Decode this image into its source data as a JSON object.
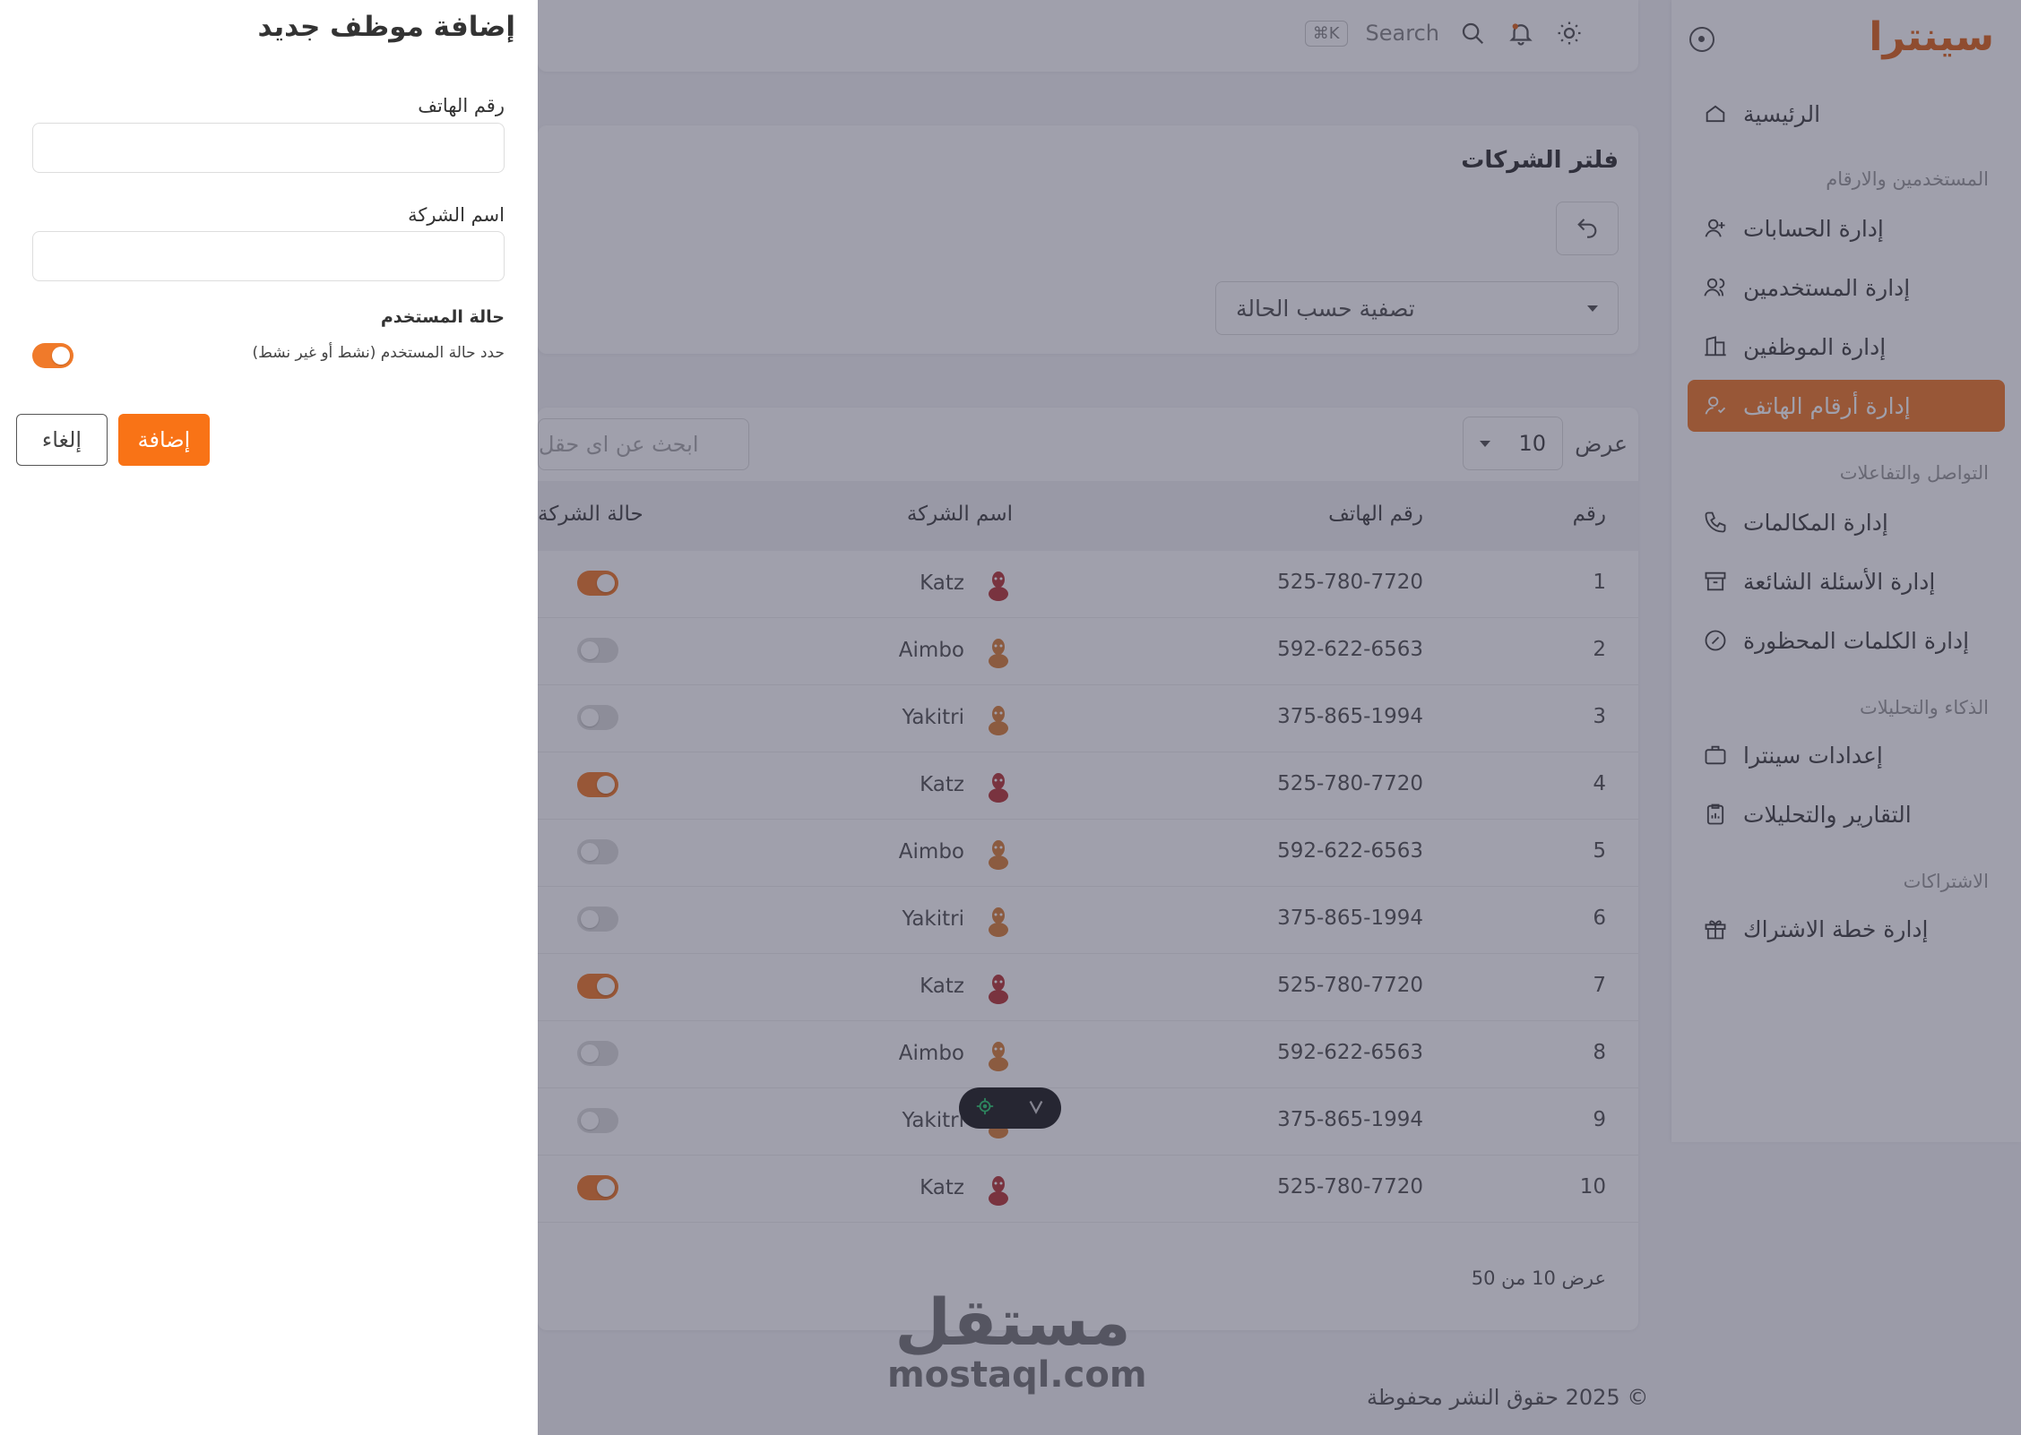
{
  "app": {
    "logo": "سينترا"
  },
  "sidebar": {
    "items": [
      {
        "label": "الرئيسية",
        "icon": "home-icon"
      },
      {
        "label": "إدارة الحسابات",
        "icon": "user-plus-icon"
      },
      {
        "label": "إدارة المستخدمين",
        "icon": "users-icon"
      },
      {
        "label": "إدارة الموظفين",
        "icon": "building-icon"
      },
      {
        "label": "إدارة أرقام الهاتف",
        "icon": "user-phone-icon",
        "active": true
      },
      {
        "label": "إدارة المكالمات",
        "icon": "phone-icon"
      },
      {
        "label": "إدارة الأسئلة الشائعة",
        "icon": "archive-icon"
      },
      {
        "label": "إدارة الكلمات المحظورة",
        "icon": "block-icon"
      },
      {
        "label": "إعدادات سينترا",
        "icon": "briefcase-icon"
      },
      {
        "label": "التقارير والتحليلات",
        "icon": "clipboard-icon"
      },
      {
        "label": "إدارة خطة الاشتراك",
        "icon": "gift-icon"
      }
    ],
    "sections": [
      "المستخدمين والارقام",
      "التواصل والتفاعلات",
      "الذكاء والتحليلات",
      "الاشتراكات"
    ]
  },
  "header": {
    "search_label": "Search",
    "shortcut": "⌘K"
  },
  "filter": {
    "title": "فلتر الشركات",
    "status_select": "تصفية حسب الحالة"
  },
  "table": {
    "show_label": "عرض",
    "page_size": "10",
    "search_placeholder": "ابحث عن اى حقل",
    "headers": {
      "num": "رقم",
      "phone": "رقم الهاتف",
      "company": "اسم الشركة",
      "status": "حالة الشركة"
    },
    "rows": [
      {
        "num": "1",
        "phone": "525-780-7720",
        "company": "Katz",
        "logo": "red",
        "active": true
      },
      {
        "num": "2",
        "phone": "592-622-6563",
        "company": "Aimbo",
        "logo": "orange",
        "active": false
      },
      {
        "num": "3",
        "phone": "375-865-1994",
        "company": "Yakitri",
        "logo": "orange",
        "active": false
      },
      {
        "num": "4",
        "phone": "525-780-7720",
        "company": "Katz",
        "logo": "red",
        "active": true
      },
      {
        "num": "5",
        "phone": "592-622-6563",
        "company": "Aimbo",
        "logo": "orange",
        "active": false
      },
      {
        "num": "6",
        "phone": "375-865-1994",
        "company": "Yakitri",
        "logo": "orange",
        "active": false
      },
      {
        "num": "7",
        "phone": "525-780-7720",
        "company": "Katz",
        "logo": "red",
        "active": true
      },
      {
        "num": "8",
        "phone": "592-622-6563",
        "company": "Aimbo",
        "logo": "orange",
        "active": false
      },
      {
        "num": "9",
        "phone": "375-865-1994",
        "company": "Yakitri",
        "logo": "orange",
        "active": false
      },
      {
        "num": "10",
        "phone": "525-780-7720",
        "company": "Katz",
        "logo": "red",
        "active": true
      }
    ],
    "footer": "عرض 10 من 50"
  },
  "footer": {
    "copyright": "© 2025 حقوق النشر محفوظة"
  },
  "watermark": {
    "ar": "مستقل",
    "en": "mostaql.com"
  },
  "drawer": {
    "title": "إضافة موظف جديد",
    "phone_label": "رقم الهاتف",
    "company_label": "اسم الشركة",
    "status_label": "حالة المستخدم",
    "status_hint": "حدد حالة المستخدم (نشط أو غير نشط)",
    "add_button": "إضافة",
    "cancel_button": "إلغاء"
  },
  "colors": {
    "accent": "#f97316",
    "sidebar_active": "#f07a2a",
    "overlay": "rgba(45,45,70,.45)"
  }
}
